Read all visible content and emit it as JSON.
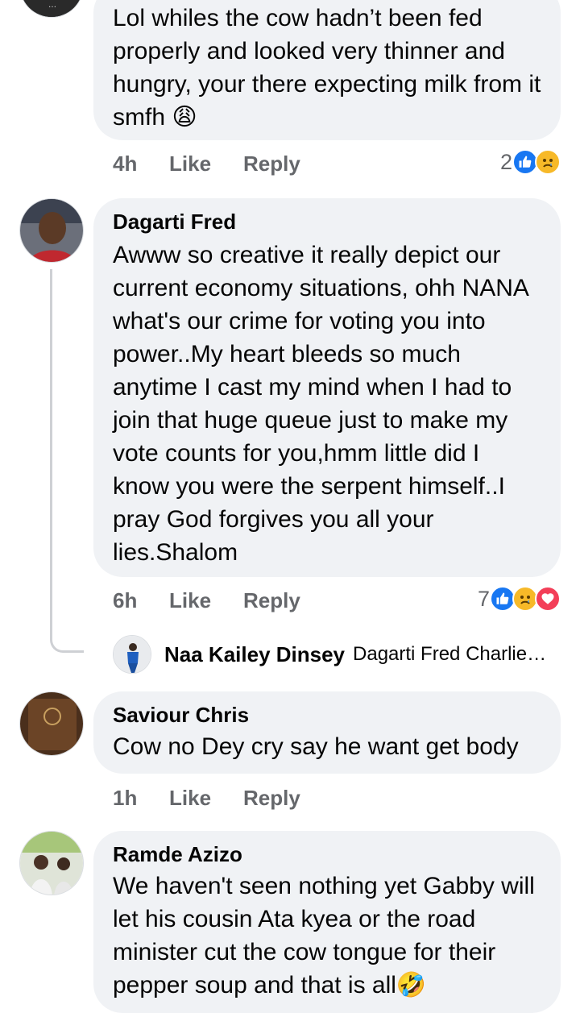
{
  "comments": [
    {
      "author": "",
      "text": "Lol whiles the cow hadn’t been fed properly and looked very thinner and hungry, your there expecting milk from it smfh 😩",
      "time": "4h",
      "like_label": "Like",
      "reply_label": "Reply",
      "reaction_count": "2",
      "reactions": [
        "like",
        "sad"
      ]
    },
    {
      "author": "Dagarti Fred",
      "text": "Awww so creative it really depict our current economy situations, ohh NANA what's our crime for voting you into power..My heart bleeds so much anytime I cast my mind when I had to join that huge queue just to make my vote counts for you,hmm little did I know you were the serpent himself..I pray God forgives you all your lies.Shalom",
      "time": "6h",
      "like_label": "Like",
      "reply_label": "Reply",
      "reaction_count": "7",
      "reactions": [
        "like",
        "sad",
        "love"
      ],
      "reply_preview": {
        "author": "Naa Kailey Dinsey",
        "text": "Dagarti Fred Charlie…"
      }
    },
    {
      "author": "Saviour Chris",
      "text": "Cow no Dey cry say he want get body",
      "time": "1h",
      "like_label": "Like",
      "reply_label": "Reply"
    },
    {
      "author": "Ramde Azizo",
      "text": "We haven't seen nothing yet Gabby will let his cousin Ata kyea or the road minister cut the cow tongue for their pepper soup and that is all🤣"
    }
  ],
  "colors": {
    "bubble": "#f0f2f5",
    "meta_text": "#65676b",
    "like_blue": "#1877f2",
    "sad_yellow": "#f7b928",
    "love_red": "#f33e58"
  }
}
